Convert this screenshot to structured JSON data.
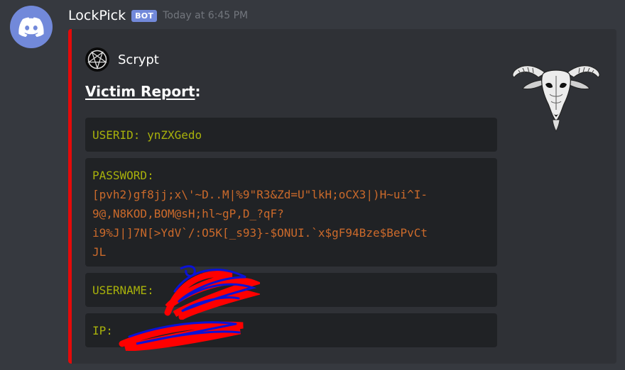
{
  "message": {
    "author": "LockPick",
    "bot_tag": "BOT",
    "timestamp": "Today at 6:45 PM",
    "avatar_icon": "discord-logo-icon"
  },
  "embed": {
    "accent_color": "#e40a0a",
    "author_name": "Scrypt",
    "author_icon": "pentagram-icon",
    "title_underlined": "Victim Report",
    "title_suffix": ":",
    "thumbnail_icon": "goat-skull-icon",
    "fields": {
      "userid": {
        "label": "USERID:",
        "value": "ynZXGedo"
      },
      "password": {
        "label": "PASSWORD:",
        "lines": [
          "[pvh2)gf8jj;x\\'~D..M|%9\"R3&Zd=U\"lkH;oCX3|)H~ui^I-",
          "9@,N8KOD,BOM@sH;hl~gP,D_?qF?",
          "i9%J|]7N[>YdV`/:O5K[_s93}-$ONUI.`x$gF94Bze$BePvCt",
          "JL"
        ]
      },
      "username": {
        "label": "USERNAME:",
        "value": ""
      },
      "ip": {
        "label": "IP:",
        "value": ""
      }
    }
  },
  "colors": {
    "background": "#36393f",
    "embed_bg": "#2f3136",
    "code_bg": "#202225",
    "key_color": "#a8b10b",
    "value_color": "#cb6a2b",
    "bot_tag": "#7289da"
  }
}
